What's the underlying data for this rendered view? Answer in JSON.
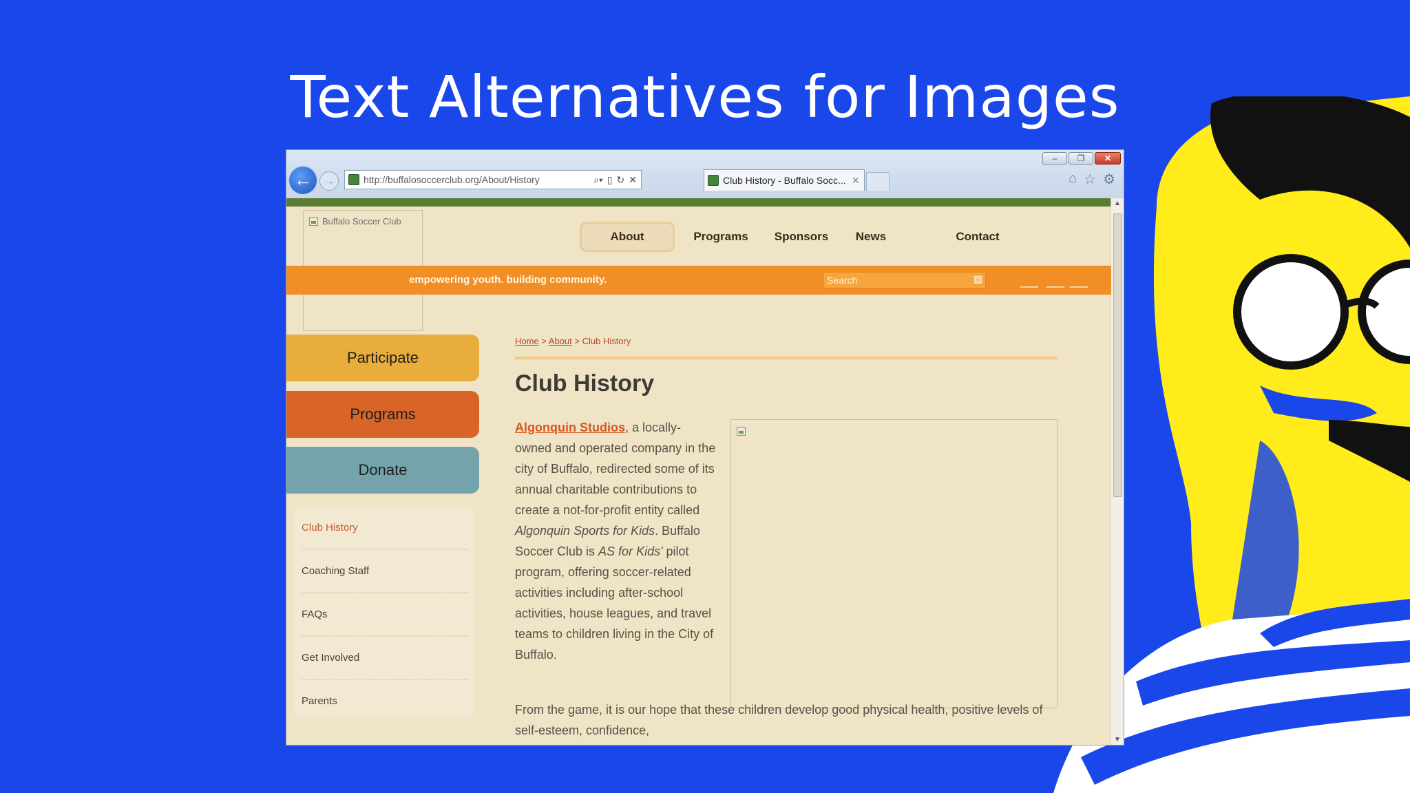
{
  "slide": {
    "title": "Text Alternatives for Images"
  },
  "browser": {
    "address_url": "http://buffalosoccerclub.org/About/History",
    "tab_title": "Club History - Buffalo Socc...",
    "nav_back_glyph": "←",
    "nav_forward_glyph": "→"
  },
  "site": {
    "logo_alt": "Buffalo Soccer Club",
    "nav": [
      "About",
      "Programs",
      "Sponsors",
      "News",
      "Contact"
    ],
    "active_nav": "About",
    "tagline": "empowering youth. building community.",
    "search_placeholder": "Search",
    "side_buttons": [
      {
        "label": "Participate",
        "color": "#e8ad3b"
      },
      {
        "label": "Programs",
        "color": "#d86427"
      },
      {
        "label": "Donate",
        "color": "#75a3ab"
      }
    ],
    "subnav": [
      "Club History",
      "Coaching Staff",
      "FAQs",
      "Get Involved",
      "Parents"
    ],
    "breadcrumb": {
      "home": "Home",
      "sep1": " > ",
      "about": "About",
      "sep2": " > ",
      "current": "Club History"
    },
    "page_title": "Club History",
    "body": {
      "link": "Algonquin Studios",
      "p1_a": ", a locally-owned and operated company in the city of Buffalo, redirected some of its annual charitable contributions to create a not-for-profit entity called ",
      "p1_em1": "Algonquin Sports for Kids",
      "p1_b": ". Buffalo Soccer Club is ",
      "p1_em2": "AS for Kids'",
      "p1_c": " pilot program, offering soccer-related activities including after-school activities, house leagues, and travel teams to children living in the City of Buffalo.",
      "p2": "From the game, it is our hope that these children develop good physical health, positive levels of self-esteem, confidence,"
    }
  },
  "colors": {
    "slide_bg": "#1a47ea",
    "green_bar": "#5b7d33",
    "orange_bar": "#f18f26",
    "page_bg": "#efe4c6",
    "link": "#d9561e"
  },
  "icons": [
    "back-arrow-icon",
    "forward-arrow-icon",
    "search-icon",
    "refresh-icon",
    "stop-icon",
    "home-icon",
    "star-icon",
    "gear-icon",
    "broken-image-icon"
  ]
}
